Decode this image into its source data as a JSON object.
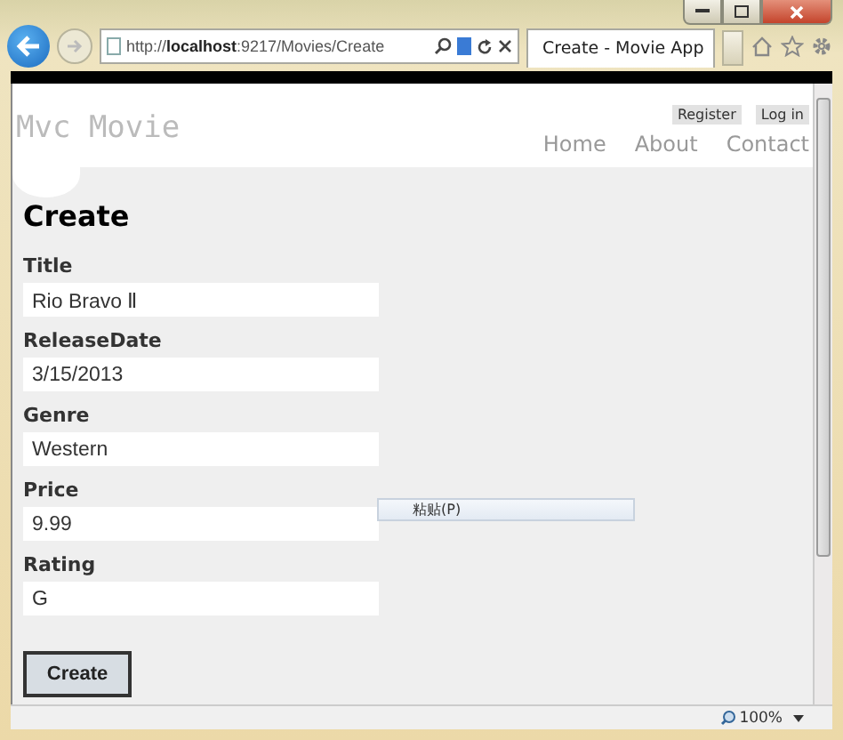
{
  "browser": {
    "address": "http://**localhost**:9217/Movies/Create",
    "tab": {
      "title": "Create - Movie App",
      "selected": true
    }
  },
  "header": {
    "logo": "Mvc Movie",
    "account_links": [
      "Register",
      "Log in"
    ],
    "nav": [
      "Home",
      "About",
      "Contact"
    ]
  },
  "page": {
    "heading": "Create",
    "fields": [
      {
        "label": "Title",
        "value": "Rio Bravo Ⅱ"
      },
      {
        "label": "ReleaseDate",
        "value": "3/15/2013"
      },
      {
        "label": "Genre",
        "value": "Western"
      },
      {
        "label": "Price",
        "value": "9.99"
      },
      {
        "label": "Rating",
        "value": "G"
      }
    ],
    "submit": "Create"
  },
  "context_menu": {
    "items": [
      "粘贴(P)"
    ]
  },
  "status_bar": {
    "zoom": "100%"
  }
}
